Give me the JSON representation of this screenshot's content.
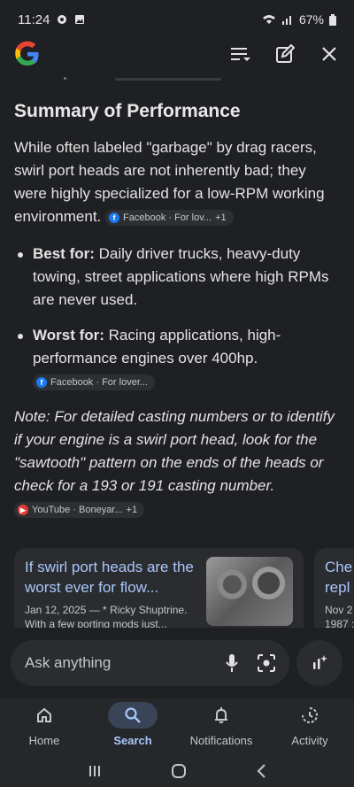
{
  "status": {
    "time": "11:24",
    "battery": "67%"
  },
  "header": {
    "logo": "google-logo"
  },
  "summary": {
    "title": "Summary of Performance",
    "intro": "While often labeled \"garbage\" by drag racers, swirl port heads are not inherently bad; they were highly specialized for a low-RPM working environment.",
    "intro_source": {
      "label": "Facebook · For lov...",
      "extra": "+1"
    },
    "bullets": [
      {
        "label": "Best for:",
        "text": " Daily driver trucks, heavy-duty towing, street applications where high RPMs are never used."
      },
      {
        "label": "Worst for:",
        "text": " Racing applications, high-performance engines over 400hp.",
        "source": "Facebook · For lover..."
      }
    ],
    "note": "Note: For detailed casting numbers or to identify if your engine is a swirl port head, look for the \"sawtooth\" pattern on the ends of the heads or check for a 193 or 191 casting number.",
    "note_source": {
      "label": "YouTube · Boneyar...",
      "extra": "+1"
    }
  },
  "cards": [
    {
      "title": "If swirl port heads are the worst ever for flow...",
      "meta": "Jan 12, 2025 — * Ricky Shuptrine. With a few porting mods just..."
    },
    {
      "title": "Che repl",
      "meta": "Nov 2 1987 :"
    }
  ],
  "ask": {
    "placeholder": "Ask anything"
  },
  "nav": [
    {
      "label": "Home",
      "icon": "home-icon"
    },
    {
      "label": "Search",
      "icon": "search-icon",
      "active": true
    },
    {
      "label": "Notifications",
      "icon": "bell-icon"
    },
    {
      "label": "Activity",
      "icon": "activity-icon"
    }
  ]
}
